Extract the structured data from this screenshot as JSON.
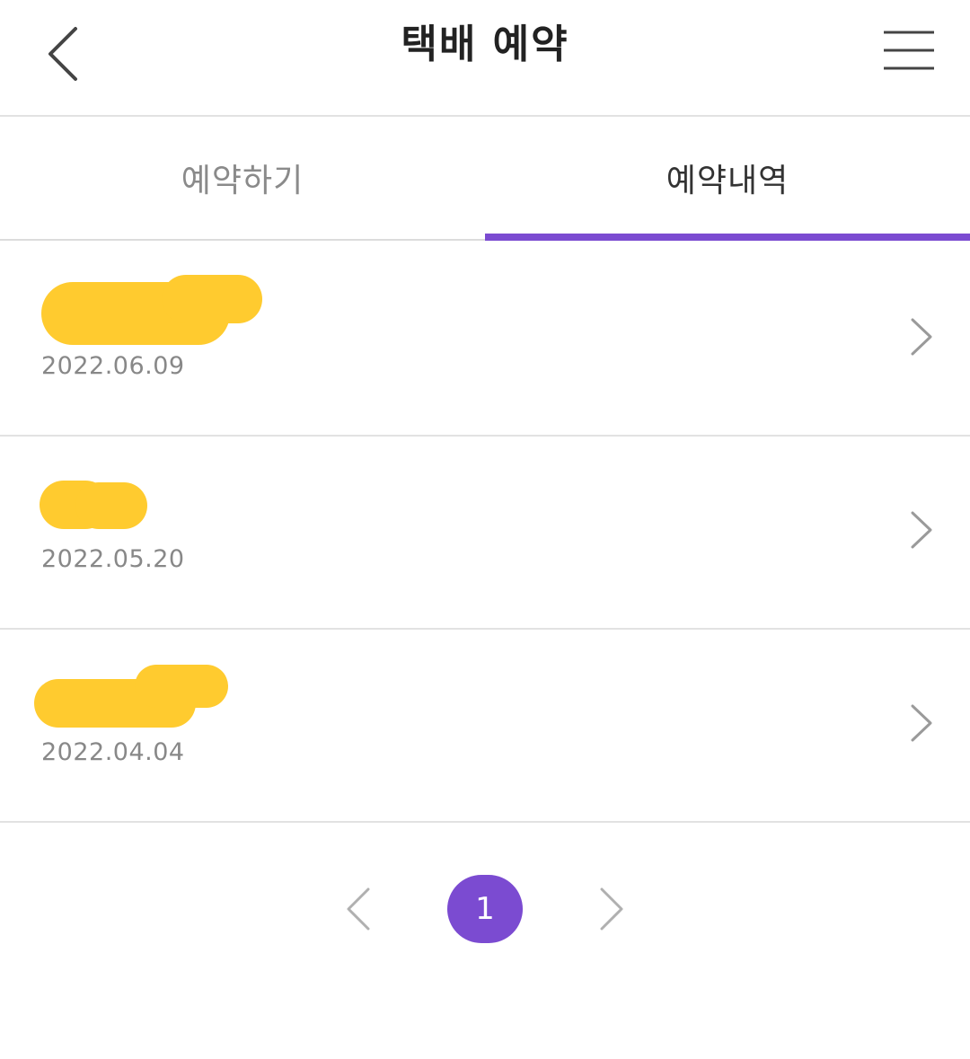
{
  "header": {
    "title": "택배 예약",
    "back_icon": "chevron-left-icon",
    "menu_icon": "hamburger-menu-icon"
  },
  "tabs": [
    {
      "label": "예약하기",
      "active": false
    },
    {
      "label": "예약내역",
      "active": true
    }
  ],
  "colors": {
    "accent": "#7b4bd1",
    "redaction": "#ffcb2f",
    "divider": "#e2e2e2",
    "muted_text": "#888888"
  },
  "reservations": [
    {
      "name": "",
      "date": "2022.06.09",
      "redacted": true
    },
    {
      "name": "",
      "date": "2022.05.20",
      "redacted": true
    },
    {
      "name": "",
      "date": "2022.04.04",
      "redacted": true
    }
  ],
  "pagination": {
    "current_page": "1",
    "prev_icon": "chevron-left-icon",
    "next_icon": "chevron-right-icon"
  }
}
